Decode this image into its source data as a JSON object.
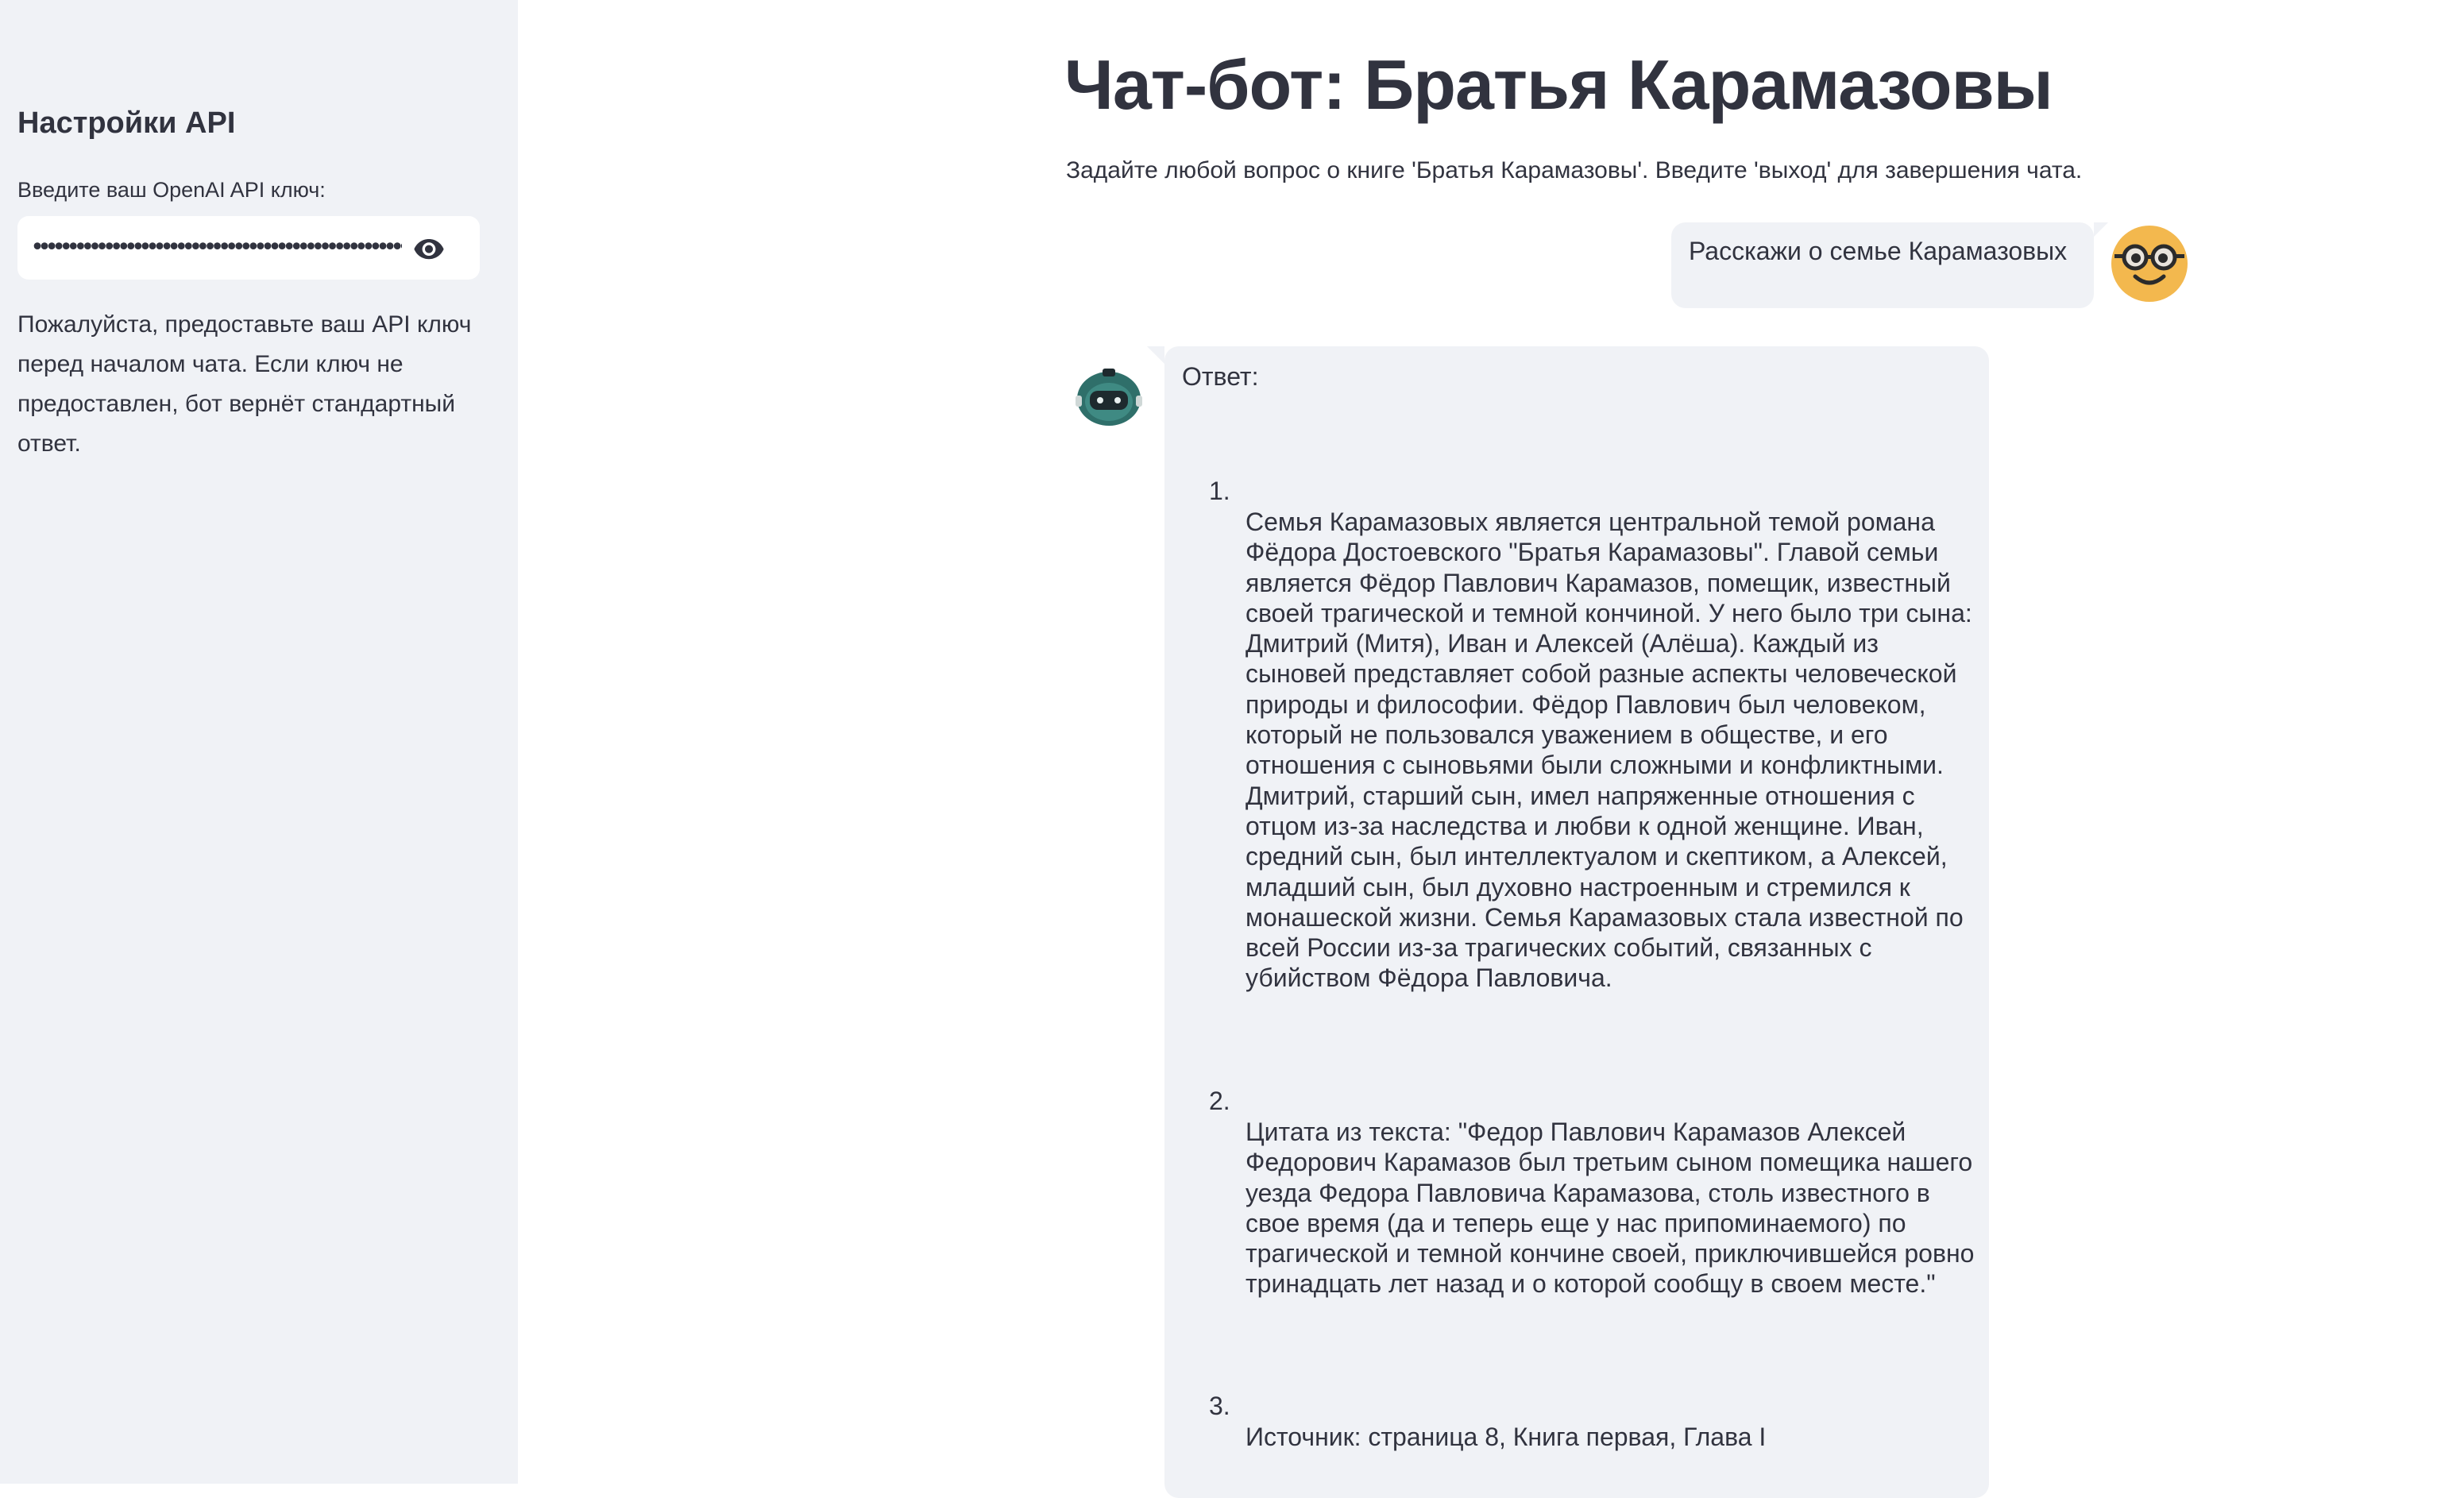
{
  "sidebar": {
    "title": "Настройки API",
    "api_key_label": "Введите ваш OpenAI API ключ:",
    "api_key_value": "••••••••••••••••••••••••••••••••••••••••••••••••••••",
    "note": "Пожалуйста, предоставьте ваш API ключ перед началом чата. Если ключ не предоставлен, бот вернёт стандартный ответ.",
    "toggle_icon": "eye-icon"
  },
  "main": {
    "title": "Чат-бот: Братья Карамазовы",
    "subtitle": "Задайте любой вопрос о книге 'Братья Карамазовы'. Введите 'выход' для завершения чата."
  },
  "chat": {
    "user_message": {
      "text": "Расскажи о семье Карамазовых",
      "avatar_icon": "nerd-face-icon"
    },
    "bot_message": {
      "avatar_icon": "robot-icon",
      "heading": "Ответ:",
      "items": [
        {
          "number": "1.",
          "text": "Семья Карамазовых является центральной темой романа Фёдора Достоевского \"Братья Карамазовы\". Главой семьи является Фёдор Павлович Карамазов, помещик, известный своей трагической и темной кончиной. У него было три сына: Дмитрий (Митя), Иван и Алексей (Алёша). Каждый из сыновей представляет собой разные аспекты человеческой природы и философии. Фёдор Павлович был человеком, который не пользовался уважением в обществе, и его отношения с сыновьями были сложными и конфликтными. Дмитрий, старший сын, имел напряженные отношения с отцом из-за наследства и любви к одной женщине. Иван, средний сын, был интеллектуалом и скептиком, а Алексей, младший сын, был духовно настроенным и стремился к монашеской жизни. Семья Карамазовых стала известной по всей России из-за трагических событий, связанных с убийством Фёдора Павловича."
        },
        {
          "number": "2.",
          "text": "Цитата из текста: \"Федор Павлович Карамазов Алексей Федорович Карамазов был третьим сыном помещика нашего уезда Федора Павловича Карамазова, столь известного в свое время (да и теперь еще у нас припоминаемого) по трагической и темной кончине своей, приключившейся ровно тринадцать лет назад и о которой сообщу в своем месте.\""
        },
        {
          "number": "3.",
          "text": "Источник: страница 8, Книга первая, Глава I"
        }
      ]
    }
  },
  "colors": {
    "sidebar_bg": "#f0f2f6",
    "text": "#31333f",
    "bubble_bg": "#f0f2f6",
    "user_avatar": "#f3b84e",
    "bot_avatar": "#2f6f6a"
  }
}
